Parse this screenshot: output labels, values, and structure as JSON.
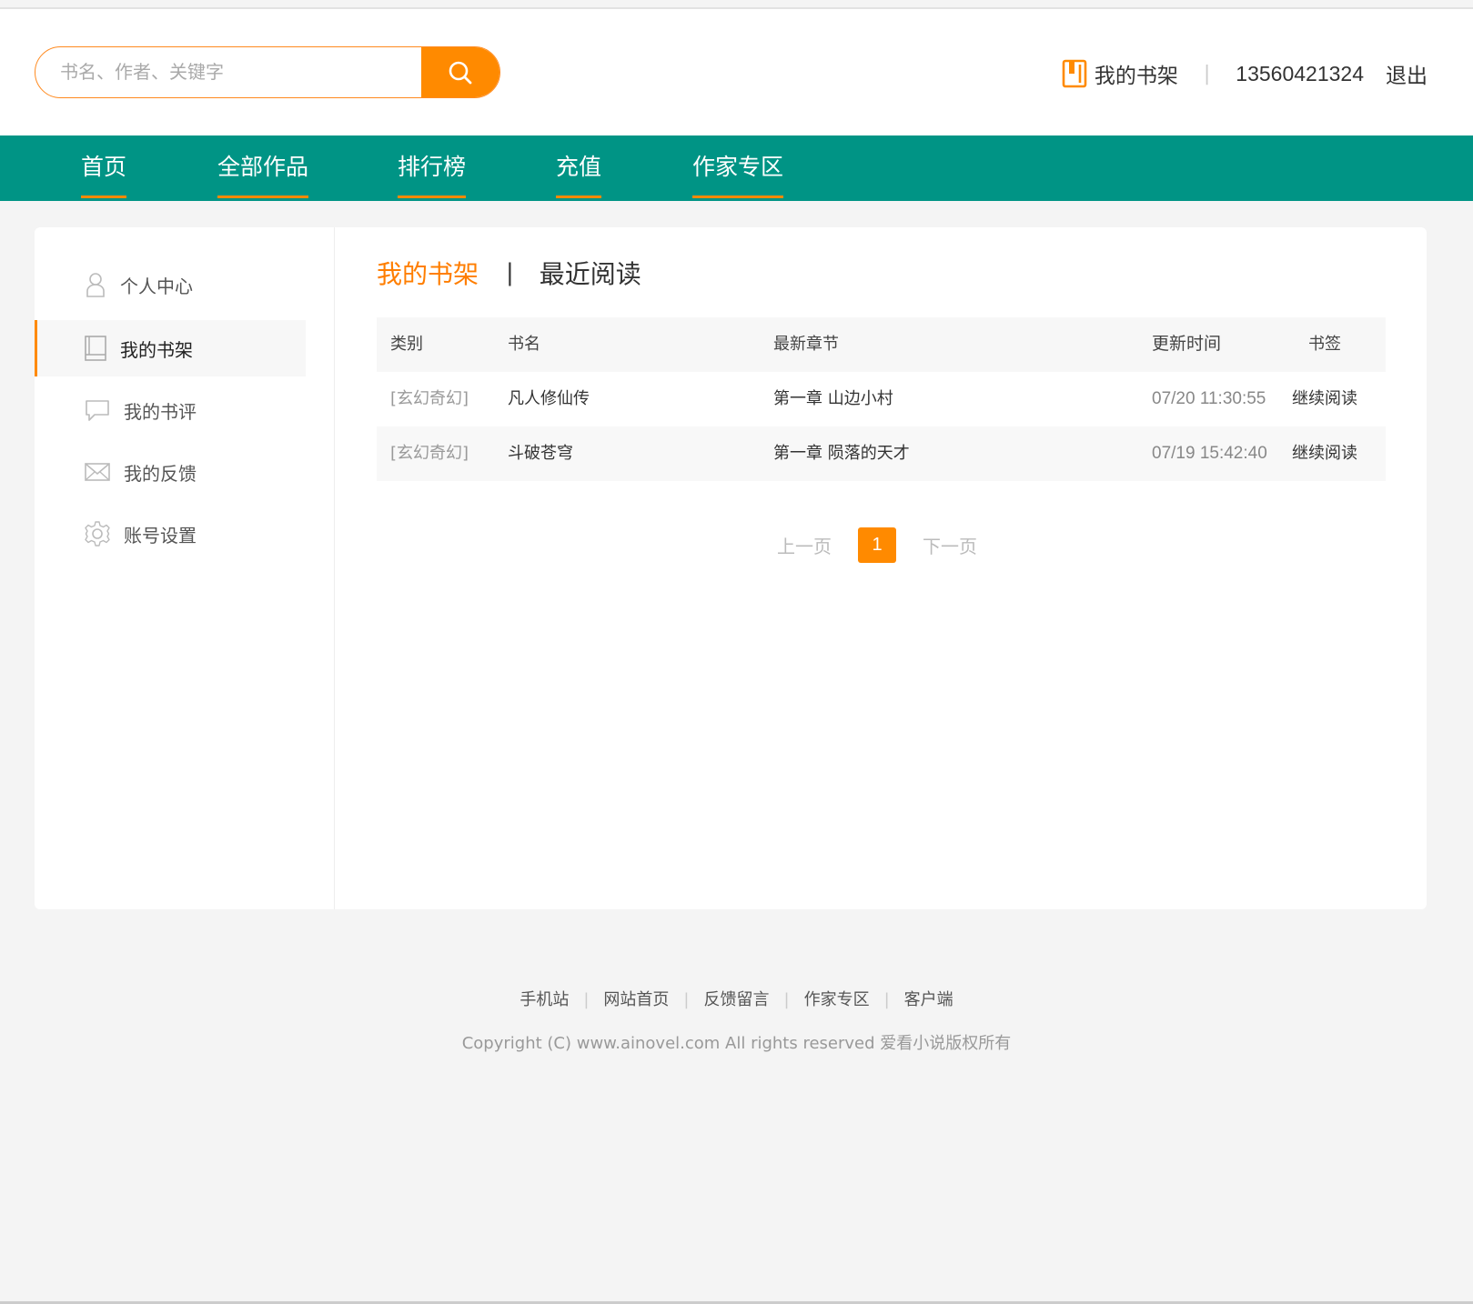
{
  "search": {
    "placeholder": "书名、作者、关键字",
    "button_icon": "search-icon"
  },
  "header": {
    "shelf_label": "我的书架",
    "phone": "13560421324",
    "logout": "退出"
  },
  "nav": {
    "items": [
      {
        "label": "首页"
      },
      {
        "label": "全部作品"
      },
      {
        "label": "排行榜"
      },
      {
        "label": "充值"
      },
      {
        "label": "作家专区"
      }
    ]
  },
  "sidebar": {
    "items": [
      {
        "label": "个人中心",
        "icon": "user-icon"
      },
      {
        "label": "我的书架",
        "icon": "book-icon",
        "active": true
      },
      {
        "label": "我的书评",
        "icon": "comment-icon"
      },
      {
        "label": "我的反馈",
        "icon": "mail-icon"
      },
      {
        "label": "账号设置",
        "icon": "gear-icon"
      }
    ]
  },
  "tabs": {
    "shelf": "我的书架",
    "separator": "|",
    "recent": "最近阅读"
  },
  "table": {
    "headers": {
      "category": "类别",
      "name": "书名",
      "chapter": "最新章节",
      "time": "更新时间",
      "bookmark": "书签"
    },
    "rows": [
      {
        "category": "[玄幻奇幻]",
        "name": "凡人修仙传",
        "chapter": "第一章 山边小村",
        "time": "07/20 11:30:55",
        "action": "继续阅读"
      },
      {
        "category": "[玄幻奇幻]",
        "name": "斗破苍穹",
        "chapter": "第一章 陨落的天才",
        "time": "07/19 15:42:40",
        "action": "继续阅读"
      }
    ]
  },
  "pager": {
    "prev": "上一页",
    "current": "1",
    "next": "下一页"
  },
  "footer": {
    "links": [
      {
        "label": "手机站"
      },
      {
        "label": "网站首页"
      },
      {
        "label": "反馈留言"
      },
      {
        "label": "作家专区"
      },
      {
        "label": "客户端"
      }
    ],
    "copyright": "Copyright (C) www.ainovel.com All rights reserved  爱看小说版权所有"
  },
  "colors": {
    "accent": "#ff8a00",
    "nav_bg": "#009485",
    "page_bg": "#f4f4f4"
  }
}
